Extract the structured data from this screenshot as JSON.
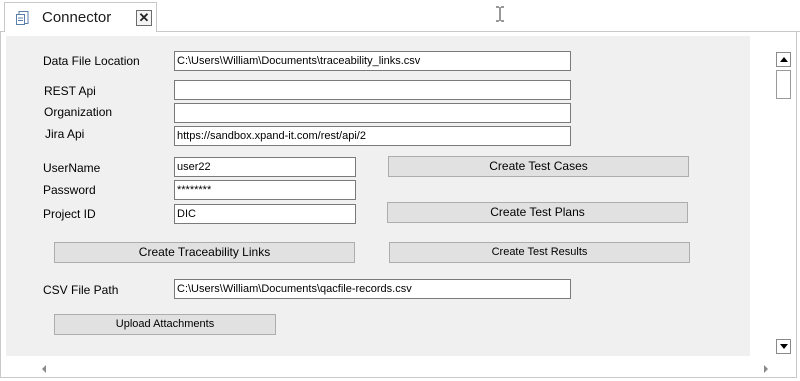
{
  "tab": {
    "title": "Connector",
    "close_symbol": "✕",
    "icon": "document-icon"
  },
  "form": {
    "data_file_location": {
      "label": "Data File Location",
      "value": "C:\\Users\\William\\Documents\\traceability_links.csv"
    },
    "rest_api": {
      "label": "REST Api",
      "value": ""
    },
    "organization": {
      "label": "Organization",
      "value": ""
    },
    "jira_api": {
      "label": "Jira Api",
      "value": "https://sandbox.xpand-it.com/rest/api/2"
    },
    "username": {
      "label": "UserName",
      "value": "user22"
    },
    "password": {
      "label": "Password",
      "value": "********"
    },
    "project_id": {
      "label": "Project ID",
      "value": "DIC"
    },
    "csv_file_path": {
      "label": "CSV File Path",
      "value": "C:\\Users\\William\\Documents\\qacfile-records.csv"
    }
  },
  "buttons": {
    "create_test_cases": "Create Test Cases",
    "create_test_plans": "Create Test Plans",
    "create_traceability_links": "Create Traceability Links",
    "create_test_results": "Create Test Results",
    "upload_attachments": "Upload Attachments"
  },
  "colors": {
    "panel_background": "#f0f0f0",
    "button_background": "#e1e1e1",
    "border": "#c9c9c9"
  }
}
